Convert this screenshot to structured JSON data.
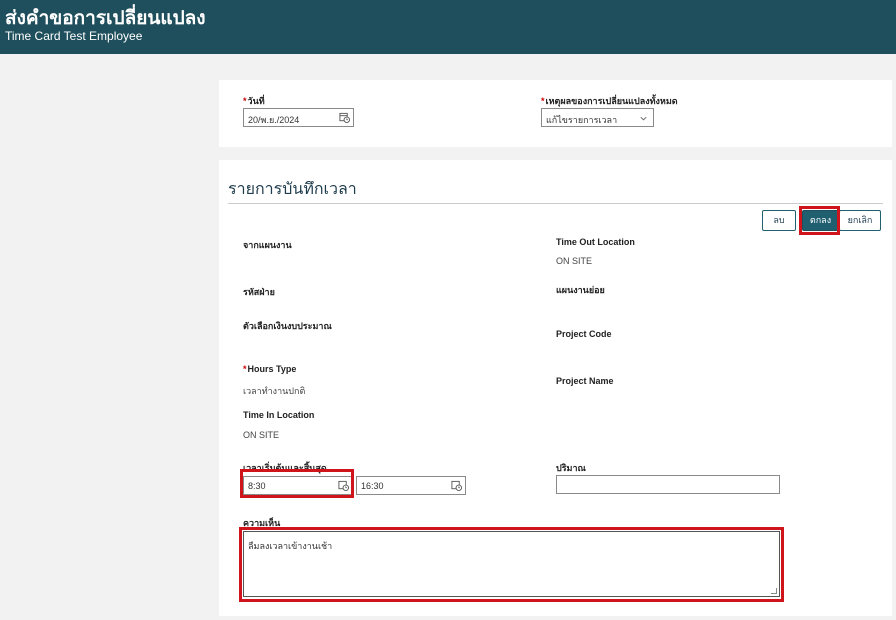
{
  "header": {
    "title": "ส่งคำขอการเปลี่ยนแปลง",
    "subtitle": "Time Card Test Employee"
  },
  "top_form": {
    "date_label": "วันที่",
    "date_value": "20/พ.ย./2024",
    "reason_label": "เหตุผลของการเปลี่ยนแปลงทั้งหมด",
    "reason_value": "แก้ไขรายการเวลา"
  },
  "time_entry": {
    "title": "รายการบันทึกเวลา",
    "buttons": {
      "delete": "ลบ",
      "ok": "ตกลง",
      "cancel": "ยกเลิก"
    },
    "left": {
      "from_plan_label": "จากแผนงาน",
      "department_code_label": "รหัสฝ่าย",
      "budget_option_label": "ตัวเลือกเงินงบประมาณ",
      "hours_type_label": "Hours Type",
      "hours_type_value": "เวลาทำงานปกติ",
      "time_in_location_label": "Time In Location",
      "time_in_location_value": "ON SITE",
      "start_end_label": "เวลาเริ่มต้นและสิ้นสุด",
      "start_time": "8:30",
      "end_time": "16:30",
      "comment_label": "ความเห็น",
      "comment_value": "ลืมลงเวลาเข้างานเช้า"
    },
    "right": {
      "time_out_location_label": "Time Out Location",
      "time_out_location_value": "ON SITE",
      "sub_plan_label": "แผนงานย่อย",
      "project_code_label": "Project Code",
      "project_name_label": "Project Name",
      "quantity_label": "ปริมาณ",
      "quantity_value": ""
    }
  },
  "icons": {
    "date_picker": "calendar-clock-icon",
    "time_picker": "clock-icon",
    "dropdown": "chevron-down-icon"
  },
  "colors": {
    "header_bg": "#1f4f5c",
    "primary_button": "#1f5f70",
    "highlight": "#d0141c"
  }
}
